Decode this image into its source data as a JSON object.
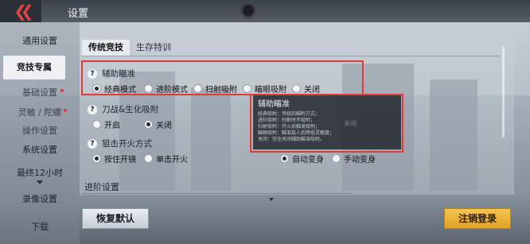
{
  "header": {
    "title": "设置"
  },
  "sidebar": {
    "items": [
      {
        "label": "通用设置"
      },
      {
        "label": "竞技专属"
      },
      {
        "label": "基础设置"
      },
      {
        "label": "灵敏 / 陀螺"
      },
      {
        "label": "操作设置"
      },
      {
        "label": "系统设置"
      },
      {
        "label": "最终12小时"
      },
      {
        "label": "录像设置"
      },
      {
        "label": "下载"
      }
    ]
  },
  "tabs": [
    {
      "label": "传统竞技"
    },
    {
      "label": "生存特训"
    }
  ],
  "aim_assist": {
    "label": "辅助瞄准",
    "options": [
      "经典模式",
      "进阶模式",
      "扫射吸附",
      "瞄眼吸附",
      "关闭"
    ],
    "selected": "经典模式"
  },
  "melee": {
    "label": "刀战&生化吸附",
    "options": [
      "开启",
      "关闭"
    ],
    "selected": "关闭"
  },
  "scope": {
    "label": "狙击开火方式",
    "options": [
      "按住开镜",
      "单击开火"
    ],
    "selected": "按住开镜"
  },
  "transform": {
    "options": [
      "自动变身",
      "手动变身"
    ],
    "selected": "自动变身"
  },
  "tooltip": {
    "title": "辅助瞄准",
    "lines": [
      "经典吸附：传统的瞄附方式；",
      "进阶吸附：扫射时不吸附；",
      "扫射吸附：开火后触发吸附；",
      "瞄眼吸附：瞄准敌人后降低灵敏度；",
      "关闭：完全关闭辅助瞄准吸附。"
    ],
    "behind_value": "关闭"
  },
  "advanced": {
    "label": "进阶设置"
  },
  "buttons": {
    "reset": "恢复默认",
    "logout": "注销登录"
  }
}
